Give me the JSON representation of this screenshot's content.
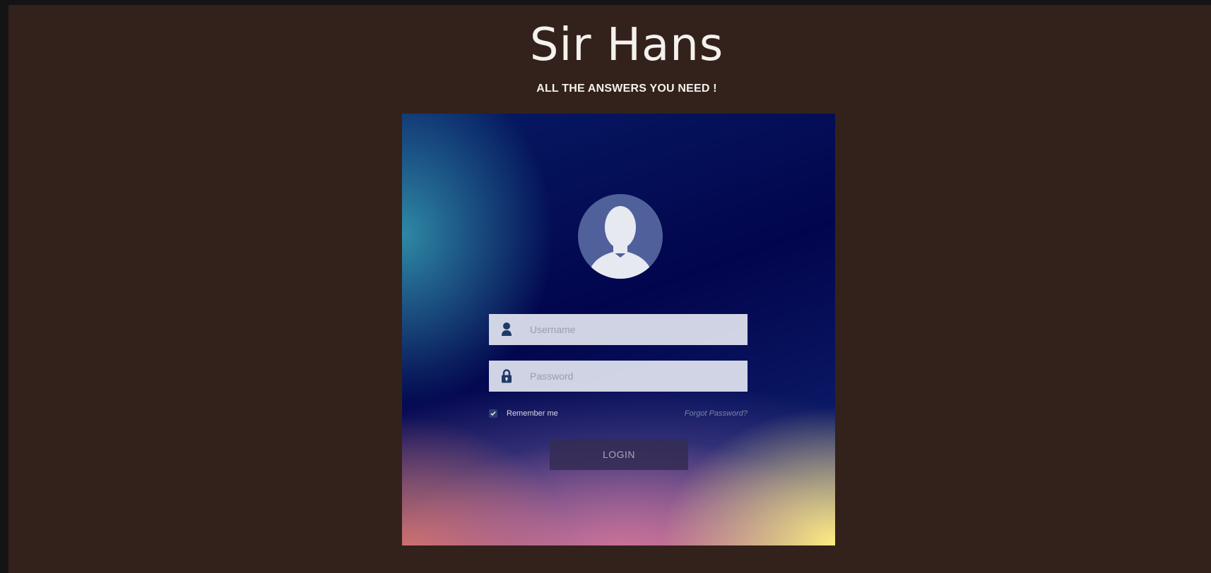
{
  "header": {
    "title": "Sir Hans",
    "subtitle": "ALL THE ANSWERS YOU NEED !"
  },
  "login_form": {
    "avatar_icon": "user-silhouette-icon",
    "username": {
      "icon": "user-icon",
      "placeholder": "Username",
      "value": ""
    },
    "password": {
      "icon": "lock-icon",
      "placeholder": "Password",
      "value": ""
    },
    "remember_me": {
      "label": "Remember me",
      "checked": true
    },
    "forgot_password_label": "Forgot Password?",
    "login_button_label": "LOGIN"
  },
  "colors": {
    "page_background": "#33221b",
    "outer_background": "#141414",
    "title_text": "#f4f1ee",
    "field_background": "#e2e5f0",
    "field_icon": "#1f3a68",
    "button_background": "#342c54"
  }
}
